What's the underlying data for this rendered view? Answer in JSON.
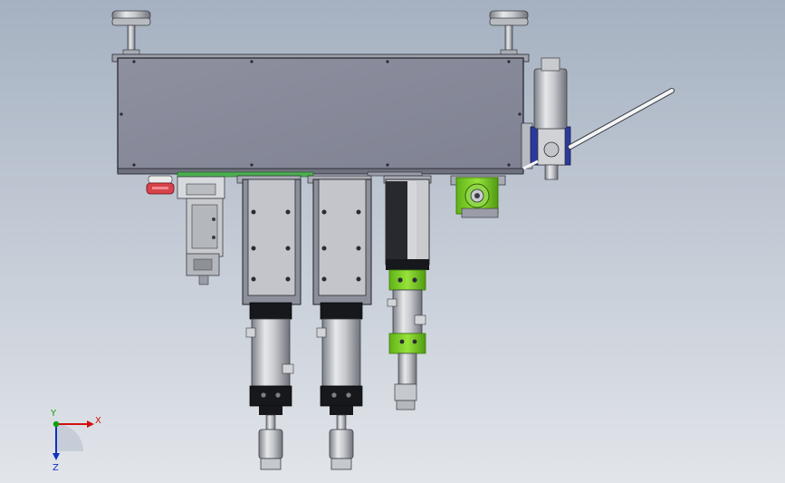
{
  "triad": {
    "x_label": "X",
    "y_label": "Y",
    "z_label": "Z"
  },
  "colors": {
    "background_top": "#a7b3c2",
    "background_bottom": "#dfe3e9",
    "plate": "#8a8c9c",
    "plate_edge": "#2a2c34",
    "steel": "#c9cbcf",
    "steel_dark": "#8f9399",
    "frame_grey": "#9a9da7",
    "black_block": "#16181c",
    "green": "#7ed321",
    "green_dark": "#3d7a0c",
    "red": "#d8434b",
    "blue": "#2c3a9c",
    "axis_x": "#d01010",
    "axis_y": "#10a010",
    "axis_z": "#1030c0"
  },
  "scene": {
    "description_icon": "cad-assembly-model",
    "parts": [
      "mounting-plate",
      "leveling-foot-left",
      "leveling-foot-right",
      "pneumatic-slide-left",
      "actuator-column-1",
      "actuator-column-2",
      "actuator-column-3",
      "gear-motor-unit",
      "filter-regulator",
      "air-hose",
      "emergency-button"
    ]
  }
}
